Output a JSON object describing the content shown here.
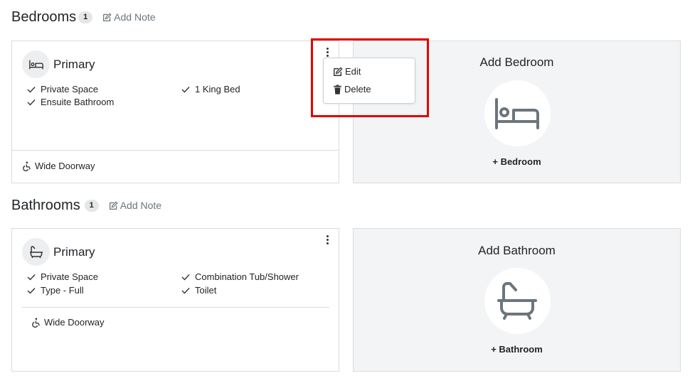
{
  "bedrooms": {
    "title": "Bedrooms",
    "count": "1",
    "add_note": "Add Note",
    "card": {
      "title": "Primary",
      "features": [
        "Private Space",
        "1 King Bed",
        "Ensuite Bathroom"
      ],
      "footer": "Wide Doorway"
    },
    "add_card": {
      "title": "Add Bedroom",
      "button": "+ Bedroom"
    }
  },
  "bathrooms": {
    "title": "Bathrooms",
    "count": "1",
    "add_note": "Add Note",
    "card": {
      "title": "Primary",
      "features": [
        "Private Space",
        "Combination Tub/Shower",
        "Type - Full",
        "Toilet"
      ],
      "footer": "Wide Doorway"
    },
    "add_card": {
      "title": "Add Bathroom",
      "button": "+ Bathroom"
    }
  },
  "dropdown": {
    "edit": "Edit",
    "delete": "Delete"
  },
  "colors": {
    "highlight": "#e00000",
    "icon_gray": "#6c757d"
  }
}
